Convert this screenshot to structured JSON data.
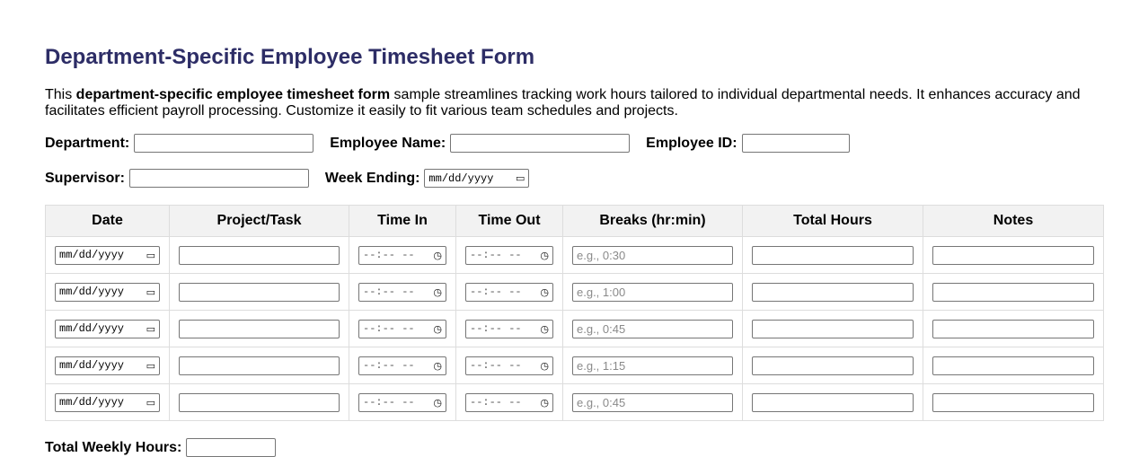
{
  "title": "Department-Specific Employee Timesheet Form",
  "intro": {
    "before": "This ",
    "bold": "department-specific employee timesheet form",
    "after": " sample streamlines tracking work hours tailored to individual departmental needs. It enhances accuracy and facilitates efficient payroll processing. Customize it easily to fit various team schedules and projects."
  },
  "fields": {
    "department_label": "Department:",
    "employee_name_label": "Employee Name:",
    "employee_id_label": "Employee ID:",
    "supervisor_label": "Supervisor:",
    "week_ending_label": "Week Ending:",
    "date_placeholder": "mm/dd/yyyy"
  },
  "table": {
    "headers": [
      "Date",
      "Project/Task",
      "Time In",
      "Time Out",
      "Breaks (hr:min)",
      "Total Hours",
      "Notes"
    ],
    "time_placeholder": "--:-- --",
    "rows": [
      {
        "break_placeholder": "e.g., 0:30"
      },
      {
        "break_placeholder": "e.g., 1:00"
      },
      {
        "break_placeholder": "e.g., 0:45"
      },
      {
        "break_placeholder": "e.g., 1:15"
      },
      {
        "break_placeholder": "e.g., 0:45"
      }
    ]
  },
  "total_weekly_hours_label": "Total Weekly Hours:",
  "icons": {
    "calendar": "calendar-icon",
    "clock": "clock-icon"
  }
}
